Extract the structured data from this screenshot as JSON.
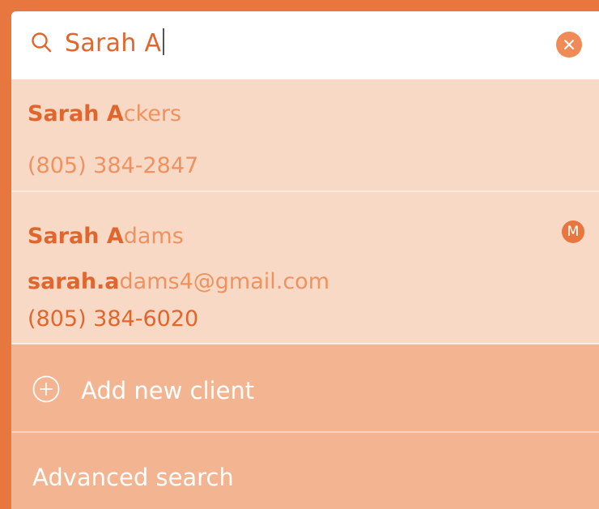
{
  "search": {
    "query": "Sarah A",
    "icon": "search-icon",
    "clear_icon": "close-icon"
  },
  "results": [
    {
      "name_typed": "Sarah A",
      "name_rest": "ckers",
      "phone": "(805) 384-2847"
    },
    {
      "name_typed": "Sarah A",
      "name_rest": "dams",
      "email_typed": "sarah.a",
      "email_rest": "dams4@gmail.com",
      "phone": "(805) 384-6020",
      "badge": "M"
    }
  ],
  "actions": {
    "add_client_label": "Add new client",
    "add_client_icon": "plus-circle-icon",
    "advanced_search_label": "Advanced search"
  },
  "colors": {
    "accent": "#e8763f",
    "highlight": "#e0662e",
    "result_bg": "#f8d9c5",
    "action_bg": "#f3b591"
  }
}
